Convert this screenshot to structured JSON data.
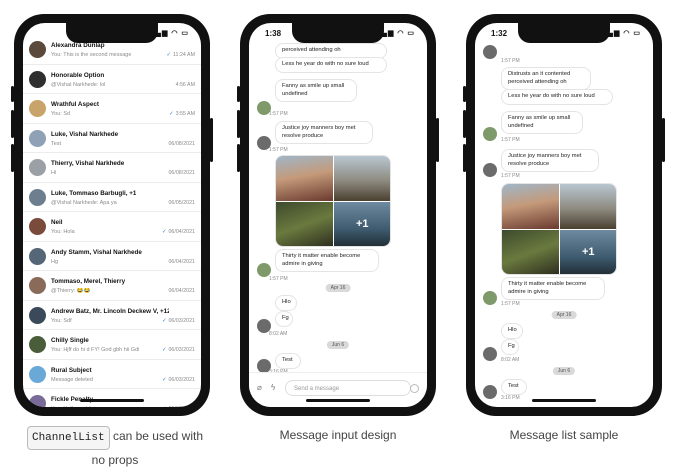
{
  "channel_list": {
    "items": [
      {
        "name": "Alexandra Dunlap",
        "preview": "You: This is the second message",
        "time": "11:24 AM",
        "checked": true,
        "avatar_color": "#5b4a3c"
      },
      {
        "name": "Honorable Option",
        "preview": "@Vishal Narkhede: lol",
        "time": "4:56 AM",
        "checked": false,
        "avatar_color": "#2f2f2f"
      },
      {
        "name": "Wrathful Aspect",
        "preview": "You: Sd",
        "time": "3:55 AM",
        "checked": true,
        "avatar_color": "#c9a46a"
      },
      {
        "name": "Luke, Vishal Narkhede",
        "preview": "Test",
        "time": "06/08/2021",
        "checked": false,
        "avatar_color": "#8fa1b5"
      },
      {
        "name": "Thierry, Vishal Narkhede",
        "preview": "Hi",
        "time": "06/08/2021",
        "checked": false,
        "avatar_color": "#9aa0a6"
      },
      {
        "name": "Luke, Tommaso Barbugli, +1",
        "preview": "@Vishal Narkhede: Apa ya",
        "time": "06/05/2021",
        "checked": false,
        "avatar_color": "#6d7f8e"
      },
      {
        "name": "Neil",
        "preview": "You: Hola",
        "time": "06/04/2021",
        "checked": true,
        "avatar_color": "#7a4a3a"
      },
      {
        "name": "Andy Stamm, Vishal Narkhede",
        "preview": "Hg",
        "time": "06/04/2021",
        "checked": false,
        "avatar_color": "#556677"
      },
      {
        "name": "Tommaso, Merel, Thierry",
        "preview": "@Thierry: 😂😂",
        "time": "06/04/2021",
        "checked": false,
        "avatar_color": "#8a6b5a"
      },
      {
        "name": "Andrew Batz, Mr. Lincoln Deckew V, +12",
        "preview": "You: Sdf",
        "time": "06/03/2021",
        "checked": true,
        "avatar_color": "#3b4a5a"
      },
      {
        "name": "Chilly Single",
        "preview": "You: Hjff do hi d FY! God gbh hii  Gdi",
        "time": "06/03/2021",
        "checked": true,
        "avatar_color": "#4a5d3a"
      },
      {
        "name": "Rural Subject",
        "preview": "Message deleted",
        "time": "06/03/2021",
        "checked": true,
        "avatar_color": "#6aa8d8"
      },
      {
        "name": "Fickle Penalty",
        "preview": "You: Hello world",
        "time": "06/03/2021",
        "checked": true,
        "avatar_color": "#7a6a9a"
      }
    ]
  },
  "phone_times": {
    "p2": "1:38",
    "p3": "1:32"
  },
  "message_input": {
    "messages": {
      "m0": "perceived attending oh",
      "m1": "Less he year do with no sure loud",
      "m2": "Fanny as smile up small undefined",
      "t2": "1:57 PM",
      "m3": "Justice joy manners boy met resolve produce",
      "t3": "1:57 PM",
      "m4": "Thirty it matter enable become admire in giving",
      "t4": "1:57 PM",
      "sep1": "Apr 16",
      "m5": "Hlo",
      "m6": "Fg",
      "t6": "8:02 AM",
      "sep2": "Jun 6",
      "m7": "Test",
      "t7": "3:16 PM",
      "more": "+1"
    },
    "placeholder": "Send a message"
  },
  "message_list": {
    "messages": {
      "top": "1:57 PM",
      "m1": "Distrusts an it contented perceived attending oh",
      "m2": "Less he year do with no sure loud",
      "m3": "Fanny as smile up small undefined",
      "t3": "1:57 PM",
      "m4": "Justice joy manners boy met resolve produce",
      "t4": "1:57 PM",
      "m5": "Thirty it matter enable become admire in giving",
      "t5": "1:57 PM",
      "sep1": "Apr 16",
      "m6": "Hlo",
      "m7": "Fg",
      "t7": "8:02 AM",
      "sep2": "Jun 6",
      "m8": "Test",
      "t8": "3:16 PM",
      "more": "+1"
    }
  },
  "captions": {
    "c1_code": "ChannelList",
    "c1_rest": " can be used with",
    "c1_line2": "no props",
    "c2": "Message input design",
    "c3": "Message list sample"
  },
  "colors": {
    "accent": "#2a7ae2",
    "phone_frame": "#111111"
  }
}
